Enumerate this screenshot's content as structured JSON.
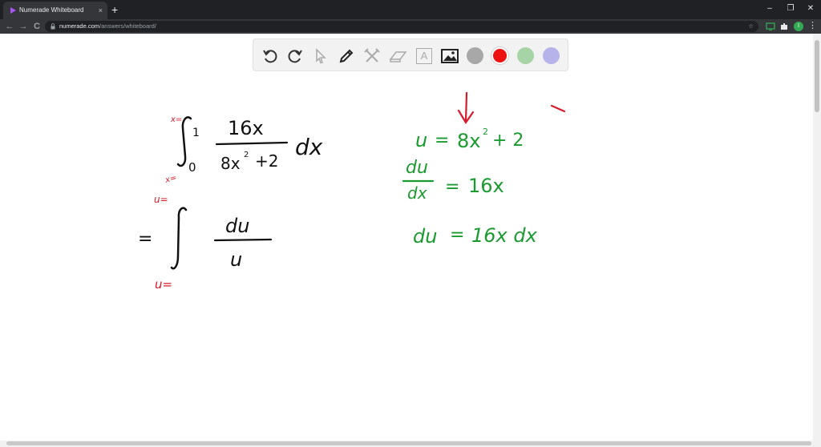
{
  "browser": {
    "tab_title": "Numerade Whiteboard",
    "tab_close": "×",
    "new_tab": "+",
    "url_domain": "numerade.com",
    "url_path": "/answers/whiteboard/",
    "window": {
      "minimize": "–",
      "restore": "❐",
      "close": "✕"
    },
    "nav": {
      "back": "←",
      "forward": "→",
      "reload": "C"
    },
    "profile_initial": "I"
  },
  "whiteboard": {
    "tools": [
      "undo-icon",
      "redo-icon",
      "select-icon",
      "pen-icon",
      "tools-icon",
      "eraser-icon",
      "text-icon",
      "image-icon"
    ],
    "text_tool_label": "A",
    "colors": [
      "#a8a8a8",
      "#ee1111",
      "#a7d4a7",
      "#b5b3ea"
    ],
    "ink_colors": {
      "black": "#111111",
      "red": "#d81b2c",
      "green": "#1a9a2f"
    }
  },
  "handwriting": {
    "integral": {
      "upper_label": "x=",
      "upper_limit": "1",
      "lower_label": "x=",
      "lower_limit": "0",
      "numerator": "16x",
      "denominator_base": "8x",
      "denominator_exp": "2",
      "denominator_rest": "+2",
      "differential": "dx"
    },
    "substituted": {
      "equals": "=",
      "upper_label": "u=",
      "lower_label": "u=",
      "numerator": "du",
      "denominator": "u"
    },
    "substitution": {
      "u_def_lhs": "u",
      "u_def_eq": "=",
      "u_def_base": "8x",
      "u_def_exp": "2",
      "u_def_rest": "+ 2",
      "deriv_num": "du",
      "deriv_den": "dx",
      "deriv_eq": "=",
      "deriv_rhs": "16x",
      "du_lhs": "du",
      "du_eq": "=",
      "du_rhs": "16x dx"
    }
  }
}
